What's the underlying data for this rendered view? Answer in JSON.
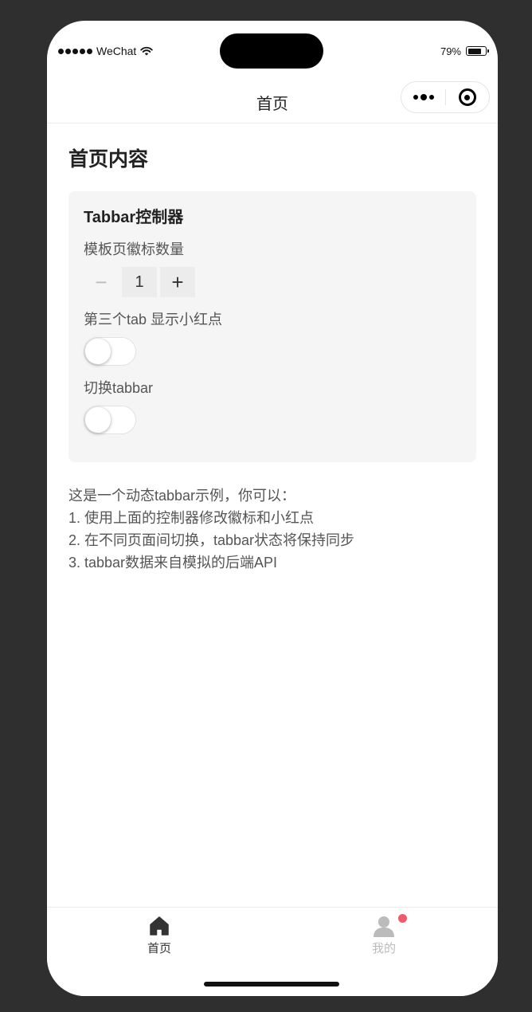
{
  "status_bar": {
    "carrier": "WeChat",
    "battery_percent": "79%",
    "battery_level": 0.79,
    "signal_icon": "signal-dots-icon",
    "wifi_icon": "wifi-icon"
  },
  "navbar": {
    "title": "首页",
    "more_icon": "more-dots-icon",
    "close_icon": "target-close-icon"
  },
  "main": {
    "page_title": "首页内容",
    "controller": {
      "title": "Tabbar控制器",
      "badge_label": "模板页徽标数量",
      "stepper": {
        "minus": "−",
        "value": "1",
        "plus": "+"
      },
      "reddot_label": "第三个tab 显示小红点",
      "reddot_switch_on": false,
      "switch_tabbar_label": "切换tabbar",
      "switch_tabbar_on": false
    },
    "description": [
      "这是一个动态tabbar示例，你可以：",
      "1. 使用上面的控制器修改徽标和小红点",
      "2. 在不同页面间切换，tabbar状态将保持同步",
      "3. tabbar数据来自模拟的后端API"
    ]
  },
  "tabbar": {
    "items": [
      {
        "label": "首页",
        "icon": "home-icon",
        "active": true,
        "color": "#333333"
      },
      {
        "label": "我的",
        "icon": "user-icon",
        "active": false,
        "color": "#bbbbbb",
        "has_reddot": true
      }
    ],
    "reddot_color": "#f05a6b"
  }
}
